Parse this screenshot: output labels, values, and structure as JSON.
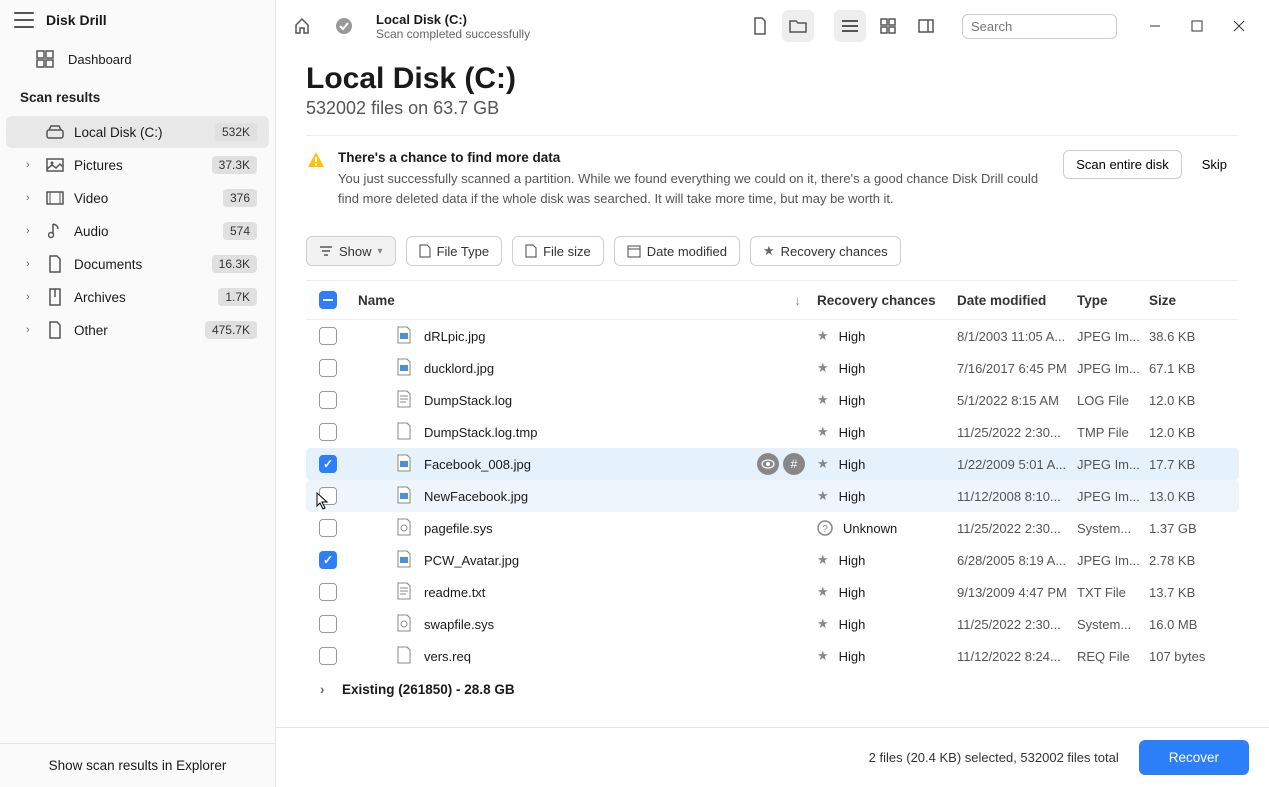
{
  "app_name": "Disk Drill",
  "dashboard_label": "Dashboard",
  "section_label": "Scan results",
  "sidebar": {
    "items": [
      {
        "label": "Local Disk (C:)",
        "badge": "532K",
        "active": true,
        "icon": "drive"
      },
      {
        "label": "Pictures",
        "badge": "37.3K",
        "icon": "picture"
      },
      {
        "label": "Video",
        "badge": "376",
        "icon": "video"
      },
      {
        "label": "Audio",
        "badge": "574",
        "icon": "audio"
      },
      {
        "label": "Documents",
        "badge": "16.3K",
        "icon": "doc"
      },
      {
        "label": "Archives",
        "badge": "1.7K",
        "icon": "archive"
      },
      {
        "label": "Other",
        "badge": "475.7K",
        "icon": "other"
      }
    ],
    "footer": "Show scan results in Explorer"
  },
  "titlebar": {
    "title": "Local Disk (C:)",
    "subtitle": "Scan completed successfully",
    "search_placeholder": "Search"
  },
  "page": {
    "title": "Local Disk (C:)",
    "subtitle": "532002 files on 63.7 GB"
  },
  "notice": {
    "title": "There's a chance to find more data",
    "text": "You just successfully scanned a partition. While we found everything we could on it, there's a good chance Disk Drill could find more deleted data if the whole disk was searched. It will take more time, but may be worth it.",
    "scan_btn": "Scan entire disk",
    "skip_btn": "Skip"
  },
  "filters": {
    "show": "Show",
    "file_type": "File Type",
    "file_size": "File size",
    "date_modified": "Date modified",
    "recovery": "Recovery chances"
  },
  "table": {
    "headers": {
      "name": "Name",
      "recovery": "Recovery chances",
      "date": "Date modified",
      "type": "Type",
      "size": "Size"
    },
    "rows": [
      {
        "name": "dRLpic.jpg",
        "recovery": "High",
        "date": "8/1/2003 11:05 A...",
        "type": "JPEG Im...",
        "size": "38.6 KB",
        "icon": "jpg"
      },
      {
        "name": "ducklord.jpg",
        "recovery": "High",
        "date": "7/16/2017 6:45 PM",
        "type": "JPEG Im...",
        "size": "67.1 KB",
        "icon": "jpg"
      },
      {
        "name": "DumpStack.log",
        "recovery": "High",
        "date": "5/1/2022 8:15 AM",
        "type": "LOG File",
        "size": "12.0 KB",
        "icon": "txt"
      },
      {
        "name": "DumpStack.log.tmp",
        "recovery": "High",
        "date": "11/25/2022 2:30...",
        "type": "TMP File",
        "size": "12.0 KB",
        "icon": "file"
      },
      {
        "name": "Facebook_008.jpg",
        "recovery": "High",
        "date": "1/22/2009 5:01 A...",
        "type": "JPEG Im...",
        "size": "17.7 KB",
        "icon": "jpg",
        "checked": true,
        "actions": true,
        "selected": true
      },
      {
        "name": "NewFacebook.jpg",
        "recovery": "High",
        "date": "11/12/2008 8:10...",
        "type": "JPEG Im...",
        "size": "13.0 KB",
        "icon": "jpg",
        "hover": true
      },
      {
        "name": "pagefile.sys",
        "recovery": "Unknown",
        "date": "11/25/2022 2:30...",
        "type": "System...",
        "size": "1.37 GB",
        "icon": "sys",
        "unknown": true
      },
      {
        "name": "PCW_Avatar.jpg",
        "recovery": "High",
        "date": "6/28/2005 8:19 A...",
        "type": "JPEG Im...",
        "size": "2.78 KB",
        "icon": "jpg",
        "checked": true
      },
      {
        "name": "readme.txt",
        "recovery": "High",
        "date": "9/13/2009 4:47 PM",
        "type": "TXT File",
        "size": "13.7 KB",
        "icon": "txt"
      },
      {
        "name": "swapfile.sys",
        "recovery": "High",
        "date": "11/25/2022 2:30...",
        "type": "System...",
        "size": "16.0 MB",
        "icon": "sys"
      },
      {
        "name": "vers.req",
        "recovery": "High",
        "date": "11/12/2022 8:24...",
        "type": "REQ File",
        "size": "107 bytes",
        "icon": "file"
      }
    ],
    "group": "Existing (261850) - 28.8 GB"
  },
  "footer": {
    "status": "2 files (20.4 KB) selected, 532002 files total",
    "recover": "Recover"
  }
}
